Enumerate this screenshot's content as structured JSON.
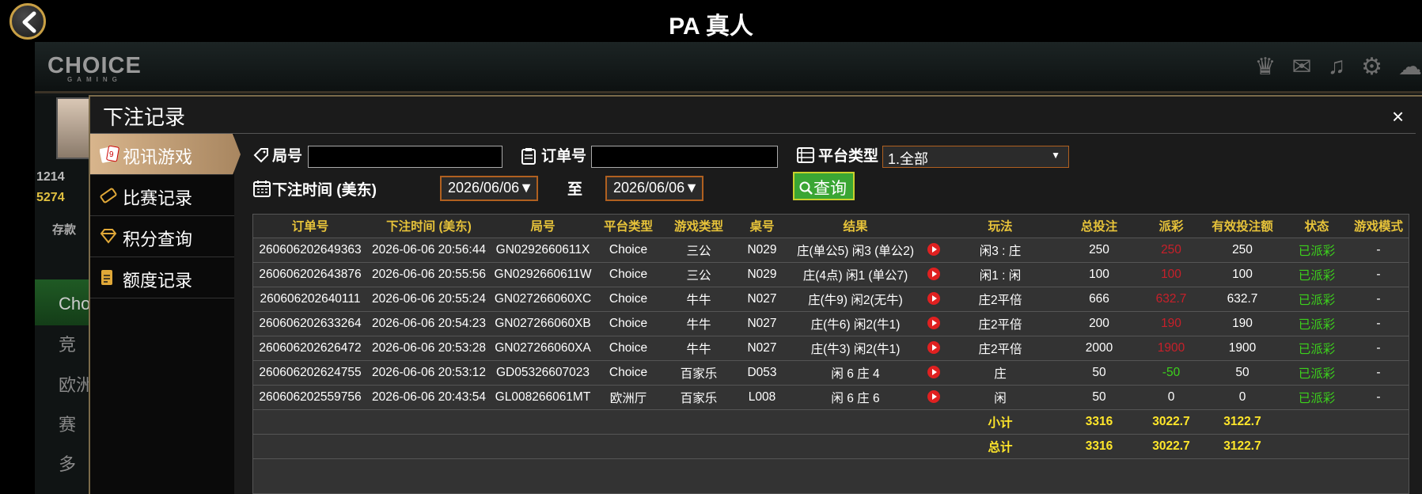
{
  "header": {
    "title": "PA 真人"
  },
  "background": {
    "logo": "CHOICE",
    "logo_sub": "GAMING",
    "stat1": "1214",
    "stat2": "5274",
    "deposit": "存款",
    "items": [
      "Cho",
      "竞",
      "欧洲",
      "赛",
      "多"
    ]
  },
  "modal": {
    "title": "下注记录",
    "close": "×",
    "sidebar": [
      {
        "label": "视讯游戏",
        "active": true
      },
      {
        "label": "比赛记录",
        "active": false
      },
      {
        "label": "积分查询",
        "active": false
      },
      {
        "label": "额度记录",
        "active": false
      }
    ]
  },
  "filters": {
    "round_label": "局号",
    "round_value": "",
    "order_label": "订单号",
    "order_value": "",
    "platform_label": "平台类型",
    "platform_value": "1.全部",
    "time_label": "下注时间 (美东)",
    "date_from": "2026/06/06",
    "to_label": "至",
    "date_to": "2026/06/06",
    "query_label": "查询"
  },
  "table": {
    "headers": [
      "订单号",
      "下注时间 (美东)",
      "局号",
      "平台类型",
      "游戏类型",
      "桌号",
      "结果",
      "玩法",
      "总投注",
      "派彩",
      "有效投注额",
      "状态",
      "游戏模式"
    ],
    "rows": [
      [
        "260606202649363",
        "2026-06-06 20:56:44",
        "GN0292660611X",
        "Choice",
        "三公",
        "N029",
        "庄(单公5) 闲3 (单公2)",
        "闲3 : 庄",
        "250",
        "250",
        "250",
        "已派彩",
        "-"
      ],
      [
        "260606202643876",
        "2026-06-06 20:55:56",
        "GN0292660611W",
        "Choice",
        "三公",
        "N029",
        "庄(4点) 闲1 (单公7)",
        "闲1 : 闲",
        "100",
        "100",
        "100",
        "已派彩",
        "-"
      ],
      [
        "260606202640111",
        "2026-06-06 20:55:24",
        "GN027266060XC",
        "Choice",
        "牛牛",
        "N027",
        "庄(牛9) 闲2(无牛)",
        "庄2平倍",
        "666",
        "632.7",
        "632.7",
        "已派彩",
        "-"
      ],
      [
        "260606202633264",
        "2026-06-06 20:54:23",
        "GN027266060XB",
        "Choice",
        "牛牛",
        "N027",
        "庄(牛6) 闲2(牛1)",
        "庄2平倍",
        "200",
        "190",
        "190",
        "已派彩",
        "-"
      ],
      [
        "260606202626472",
        "2026-06-06 20:53:28",
        "GN027266060XA",
        "Choice",
        "牛牛",
        "N027",
        "庄(牛3) 闲2(牛1)",
        "庄2平倍",
        "2000",
        "1900",
        "1900",
        "已派彩",
        "-"
      ],
      [
        "260606202624755",
        "2026-06-06 20:53:12",
        "GD05326607023",
        "Choice",
        "百家乐",
        "D053",
        "闲 6 庄 4",
        "庄",
        "50",
        "-50",
        "50",
        "已派彩",
        "-"
      ],
      [
        "260606202559756",
        "2026-06-06 20:43:54",
        "GL008266061MT",
        "欧洲厅",
        "百家乐",
        "L008",
        "闲 6 庄 6",
        "闲",
        "50",
        "0",
        "0",
        "已派彩",
        "-"
      ]
    ],
    "payout_colors": [
      "red",
      "red",
      "red",
      "red",
      "red",
      "grn",
      "white"
    ],
    "subtotal": {
      "label": "小计",
      "bet": "3316",
      "payout": "3022.7",
      "valid": "3122.7"
    },
    "total": {
      "label": "总计",
      "bet": "3316",
      "payout": "3022.7",
      "valid": "3122.7"
    }
  }
}
